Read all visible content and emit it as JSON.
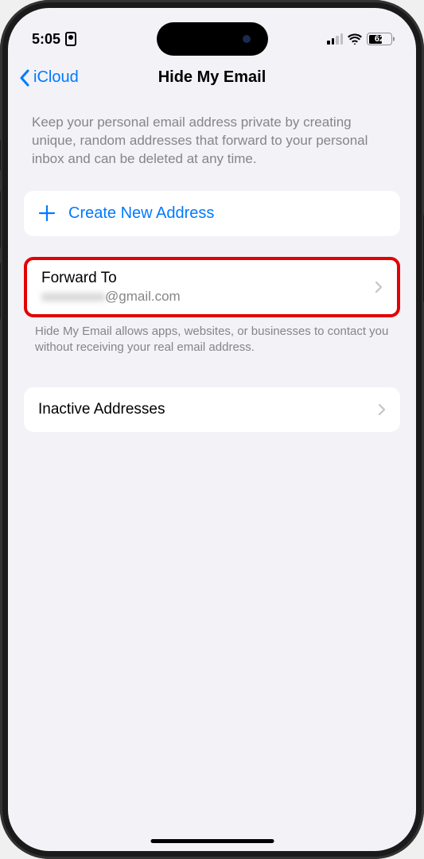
{
  "statusBar": {
    "time": "5:05",
    "batteryPercent": "62"
  },
  "nav": {
    "backLabel": "iCloud",
    "title": "Hide My Email"
  },
  "description": "Keep your personal email address private by creating unique, random addresses that forward to your personal inbox and can be deleted at any time.",
  "createButton": {
    "label": "Create New Address"
  },
  "forwardTo": {
    "title": "Forward To",
    "emailPrefix": "xxxxxxxxxx",
    "emailSuffix": "@gmail.com"
  },
  "footerText": "Hide My Email allows apps, websites, or businesses to contact you without receiving your real email address.",
  "inactiveAddresses": {
    "label": "Inactive Addresses"
  }
}
